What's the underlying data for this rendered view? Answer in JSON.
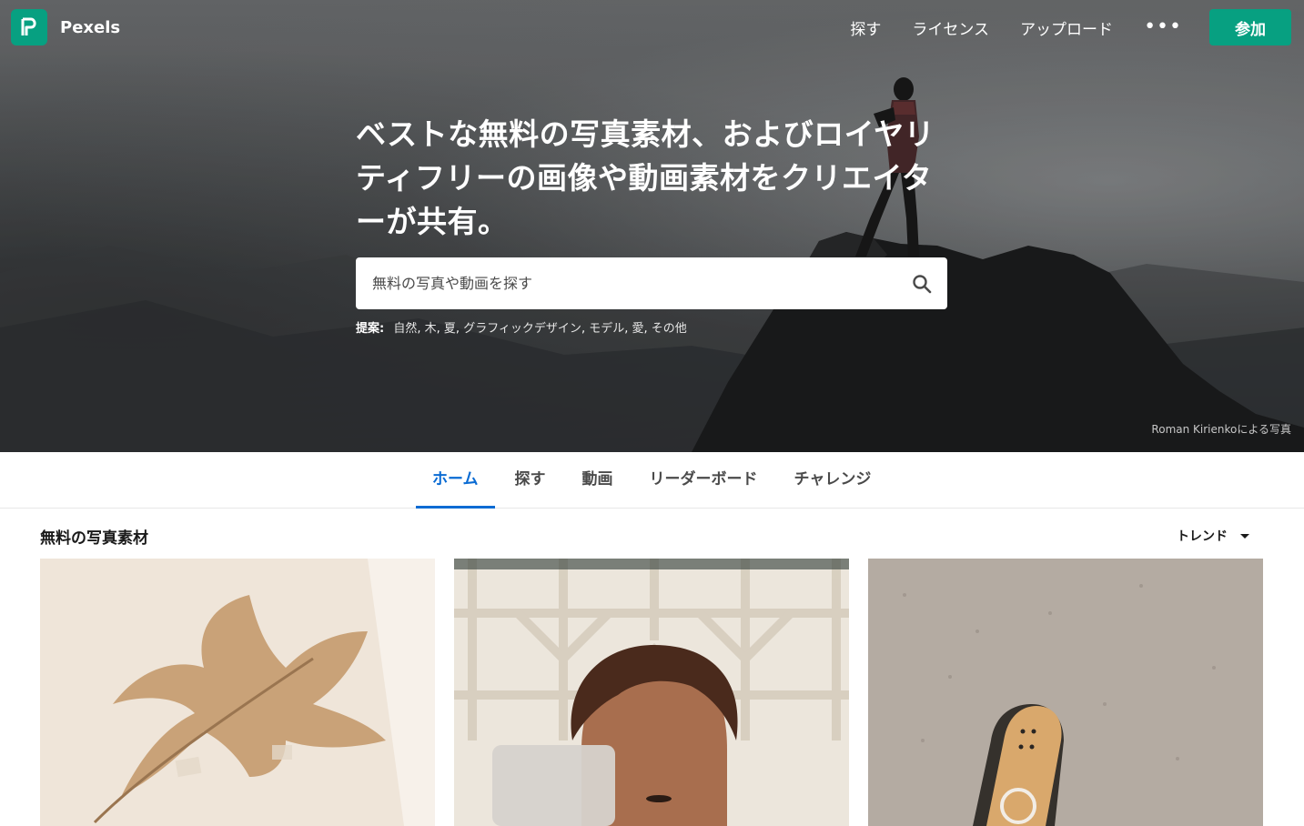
{
  "brand": {
    "name": "Pexels",
    "color": "#07a081"
  },
  "nav": {
    "links": [
      "探す",
      "ライセンス",
      "アップロード"
    ],
    "more_label": "•••",
    "join_label": "参加"
  },
  "hero": {
    "title": "ベストな無料の写真素材、およびロイヤリティフリーの画像や動画素材をクリエイターが共有。",
    "search_placeholder": "無料の写真や動画を探す",
    "suggest_label": "提案:",
    "suggestions": [
      "自然",
      "木",
      "夏",
      "グラフィックデザイン",
      "モデル",
      "愛",
      "その他"
    ],
    "credit": "Roman Kirienkoによる写真"
  },
  "tabs": [
    {
      "label": "ホーム",
      "active": true
    },
    {
      "label": "探す",
      "active": false
    },
    {
      "label": "動画",
      "active": false
    },
    {
      "label": "リーダーボード",
      "active": false
    },
    {
      "label": "チャレンジ",
      "active": false
    }
  ],
  "section": {
    "title": "無料の写真素材",
    "sort_label": "トレンド"
  },
  "colors": {
    "accent": "#0a6bd3",
    "join": "#07a081"
  }
}
